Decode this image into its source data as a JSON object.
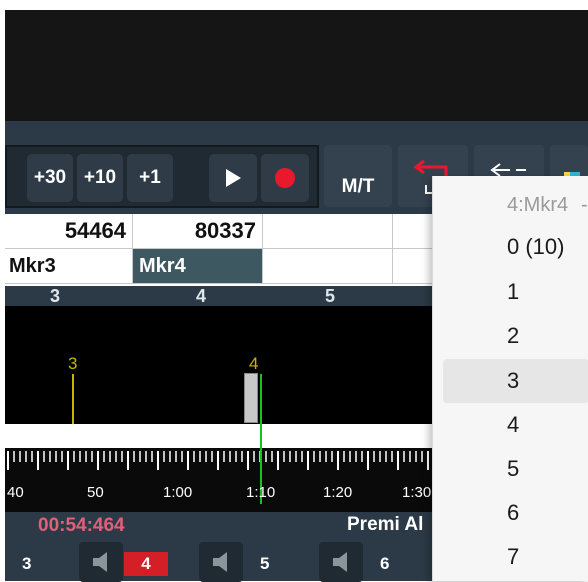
{
  "toolbar": {
    "plus30": "+30",
    "plus10": "+10",
    "plus1": "+1",
    "play_icon": "play-icon",
    "record_icon": "record-icon",
    "mt_label": "M/T",
    "colors": {
      "record": "#e8192c",
      "loop_arrow": "#e8192c"
    }
  },
  "grid": {
    "row1": [
      "54464",
      "80337",
      "",
      ""
    ],
    "row2": [
      "Mkr3",
      "Mkr4",
      "",
      ""
    ]
  },
  "marker_numbers": [
    "3",
    "4",
    "5"
  ],
  "waveform": {
    "marker_labels": [
      "3",
      "4"
    ],
    "marker_colors": {
      "mkr3": "#c9b400",
      "mkr4": "#c9b400",
      "playhead": "#19c219"
    }
  },
  "ruler": {
    "labels": [
      "40",
      "50",
      "1:00",
      "1:10",
      "1:20",
      "1:30"
    ]
  },
  "status": {
    "time": "00:54:464",
    "message": "Premi Al",
    "channels": [
      "3",
      "4",
      "5",
      "6"
    ],
    "active_channel": "4",
    "colors": {
      "time": "#e0607a",
      "active_channel_bg": "#d41f26"
    }
  },
  "menu": {
    "header": "4:Mkr4",
    "items": [
      "0 (10)",
      "1",
      "2",
      "3",
      "4",
      "5",
      "6",
      "7"
    ],
    "highlighted": "3"
  }
}
